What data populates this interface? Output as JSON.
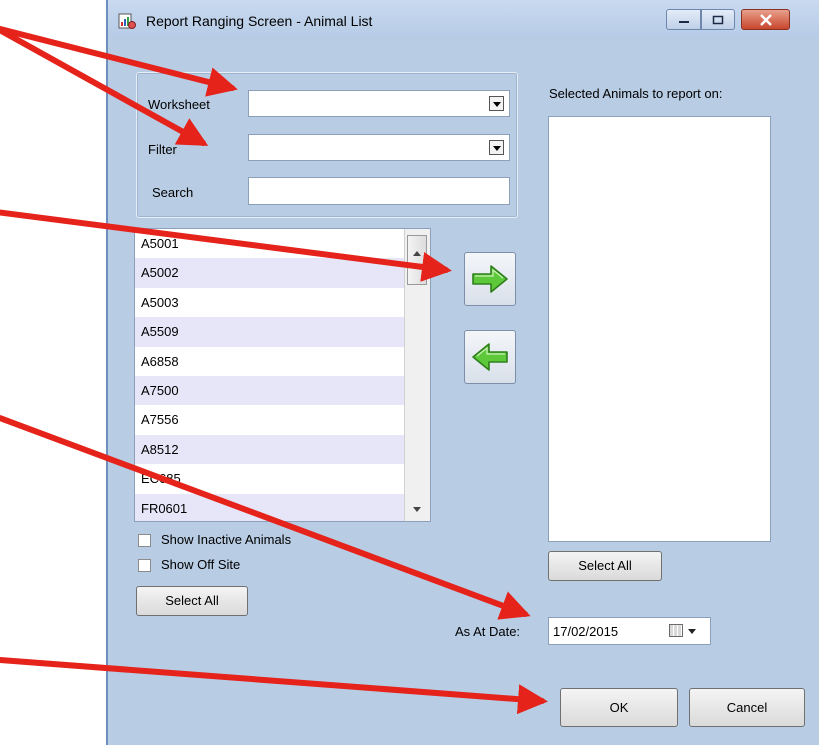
{
  "window": {
    "title": "Report Ranging Screen - Animal List"
  },
  "filters": {
    "worksheet_label": "Worksheet",
    "worksheet_value": "",
    "filter_label": "Filter",
    "filter_value": "",
    "search_label": "Search",
    "search_value": ""
  },
  "animal_list": {
    "items": [
      "A5001",
      "A5002",
      "A5003",
      "A5509",
      "A6858",
      "A7500",
      "A7556",
      "A8512",
      "EC685",
      "FR0601"
    ]
  },
  "options": {
    "show_inactive_label": "Show Inactive Animals",
    "show_inactive_checked": false,
    "show_off_site_label": "Show Off Site",
    "show_off_site_checked": false,
    "select_all_left_label": "Select All"
  },
  "selected": {
    "heading": "Selected Animals to report on:",
    "items": [],
    "select_all_label": "Select All"
  },
  "as_at": {
    "label": "As At Date:",
    "value": "17/02/2015"
  },
  "actions": {
    "ok_label": "OK",
    "cancel_label": "Cancel"
  },
  "colors": {
    "window_bg": "#b8cce4",
    "list_alt_row": "#e6e6f8",
    "annotation_arrow": "#e5231b",
    "move_arrow_green": "#5cc83a"
  },
  "icons": {
    "app": "report-app-icon",
    "move_right": "green-right-arrow-icon",
    "move_left": "green-left-arrow-icon",
    "calendar": "calendar-icon"
  }
}
